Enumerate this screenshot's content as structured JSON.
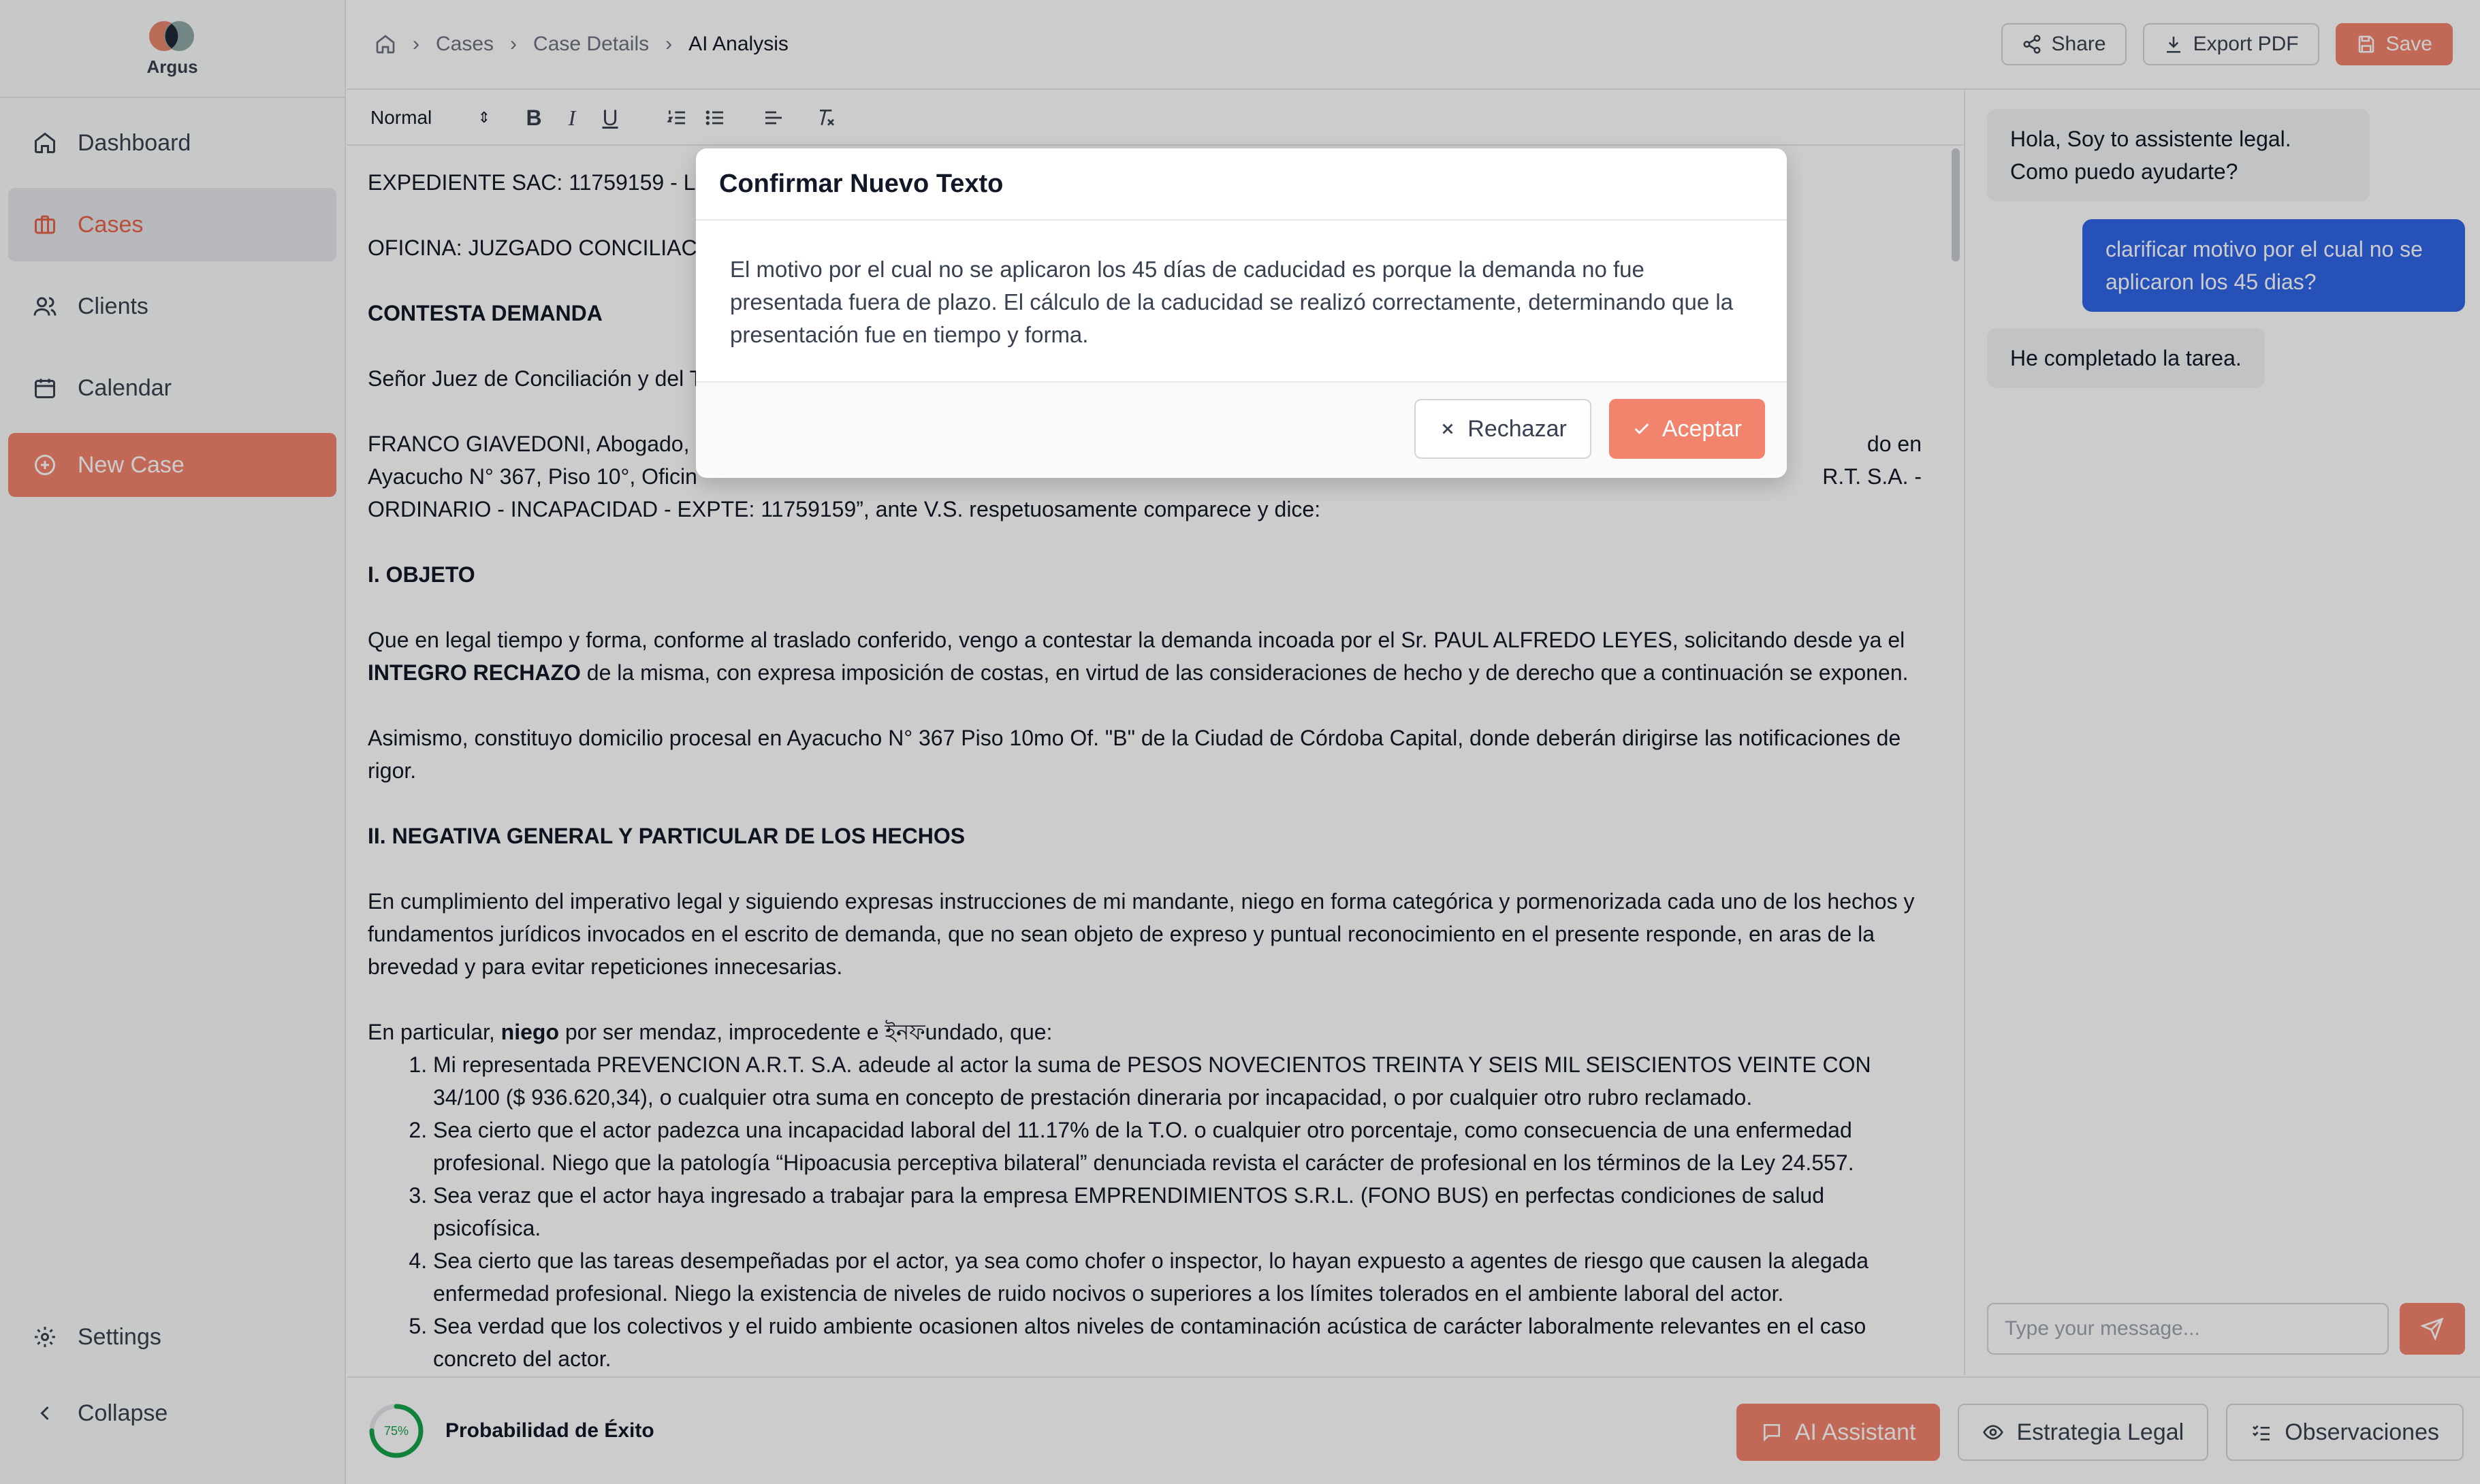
{
  "app": {
    "name": "Argus"
  },
  "sidebar": {
    "items": [
      {
        "label": "Dashboard",
        "icon": "home-icon"
      },
      {
        "label": "Cases",
        "icon": "briefcase-icon",
        "active": true
      },
      {
        "label": "Clients",
        "icon": "users-icon"
      },
      {
        "label": "Calendar",
        "icon": "calendar-icon"
      },
      {
        "label": "New Case",
        "icon": "plus-circle-icon"
      }
    ],
    "bottom": [
      {
        "label": "Settings",
        "icon": "gear-icon"
      },
      {
        "label": "Collapse",
        "icon": "chevron-left-icon"
      }
    ]
  },
  "header": {
    "breadcrumbs": [
      "Cases",
      "Case Details",
      "AI Analysis"
    ],
    "share_label": "Share",
    "export_label": "Export PDF",
    "save_label": "Save"
  },
  "toolbar": {
    "format_value": "Normal"
  },
  "document": {
    "line1": "EXPEDIENTE SAC: 11759159 - L",
    "line2": "OFICINA: JUZGADO CONCILIAC",
    "heading1": "CONTESTA DEMANDA",
    "line3": "Señor Juez de Conciliación y del T",
    "para_franco_a": "FRANCO GIAVEDONI, Abogado,",
    "para_franco_a_tail": "do en",
    "para_franco_b": "Ayacucho N° 367, Piso 10°, Oficin",
    "para_franco_b_tail": "R.T. S.A. -",
    "para_franco_c": "ORDINARIO - INCAPACIDAD - EXPTE: 11759159”, ante V.S. respetuosamente comparece y dice:",
    "heading2": "I. OBJETO",
    "para_objeto_1": "Que en legal tiempo y forma, conforme al traslado conferido, vengo a contestar la demanda incoada por el Sr. PAUL ALFREDO LEYES, solicitando desde ya el",
    "para_objeto_bold": "INTEGRO RECHAZO",
    "para_objeto_2": " de la misma, con expresa imposición de costas, en virtud de las consideraciones de hecho y de derecho que a continuación se exponen.",
    "para_domicilio": "Asimismo, constituyo domicilio procesal en Ayacucho N° 367 Piso 10mo Of. \"B\" de la Ciudad de Córdoba Capital, donde deberán dirigirse las notificaciones de rigor.",
    "heading3": "II. NEGATIVA GENERAL Y PARTICULAR DE LOS HECHOS",
    "para_negativa": "En cumplimiento del imperativo legal y siguiendo expresas instrucciones de mi mandante, niego en forma categórica y pormenorizada cada uno de los hechos y fundamentos jurídicos invocados en el escrito de demanda, que no sean objeto de expreso y puntual reconocimiento en el presente responde, en aras de la brevedad y para evitar repeticiones innecesarias.",
    "para_particular_a": "En particular, ",
    "para_particular_bold": "niego",
    "para_particular_b": " por ser mendaz, improcedente e ইনফundado, que:",
    "list": [
      "Mi representada PREVENCION A.R.T. S.A. adeude al actor la suma de PESOS NOVECIENTOS TREINTA Y SEIS MIL SEISCIENTOS VEINTE CON 34/100 ($ 936.620,34), o cualquier otra suma en concepto de prestación dineraria por incapacidad, o por cualquier otro rubro reclamado.",
      "Sea cierto que el actor padezca una incapacidad laboral del 11.17% de la T.O. o cualquier otro porcentaje, como consecuencia de una enfermedad profesional. Niego que la patología “Hipoacusia perceptiva bilateral” denunciada revista el carácter de profesional en los términos de la Ley 24.557.",
      "Sea veraz que el actor haya ingresado a trabajar para la empresa EMPRENDIMIENTOS S.R.L. (FONO BUS) en perfectas condiciones de salud psicofísica.",
      "Sea cierto que las tareas desempeñadas por el actor, ya sea como chofer o inspector, lo hayan expuesto a agentes de riesgo que causen la alegada enfermedad profesional. Niego la existencia de niveles de ruido nocivos o superiores a los límites tolerados en el ambiente laboral del actor.",
      "Sea verdad que los colectivos y el ruido ambiente ocasionen altos niveles de contaminación acústica de carácter laboralmente relevantes en el caso concreto del actor."
    ]
  },
  "footer": {
    "probability_value": "75%",
    "probability_fraction": 0.75,
    "probability_label": "Probabilidad de Éxito",
    "ai_assistant_label": "AI Assistant",
    "estrategia_label": "Estrategia Legal",
    "observaciones_label": "Observaciones"
  },
  "chat": {
    "messages": [
      {
        "role": "assistant",
        "text": "Hola, Soy to assistente legal. Como puedo ayudarte?"
      },
      {
        "role": "user",
        "text": "clarificar motivo por el cual no se aplicaron los 45 dias?"
      },
      {
        "role": "assistant",
        "text": "He completado la tarea."
      }
    ],
    "input_placeholder": "Type your message..."
  },
  "modal": {
    "title": "Confirmar Nuevo Texto",
    "body": "El motivo por el cual no se aplicaron los 45 días de caducidad es porque la demanda no fue presentada fuera de plazo. El cálculo de la caducidad se realizó correctamente, determinando que la presentación fue en tiempo y forma.",
    "reject_label": "Rechazar",
    "accept_label": "Aceptar"
  },
  "colors": {
    "accent": "#f2836d",
    "accent_text": "#e8624a",
    "user_bubble": "#2f66e8",
    "success": "#16a34a"
  }
}
